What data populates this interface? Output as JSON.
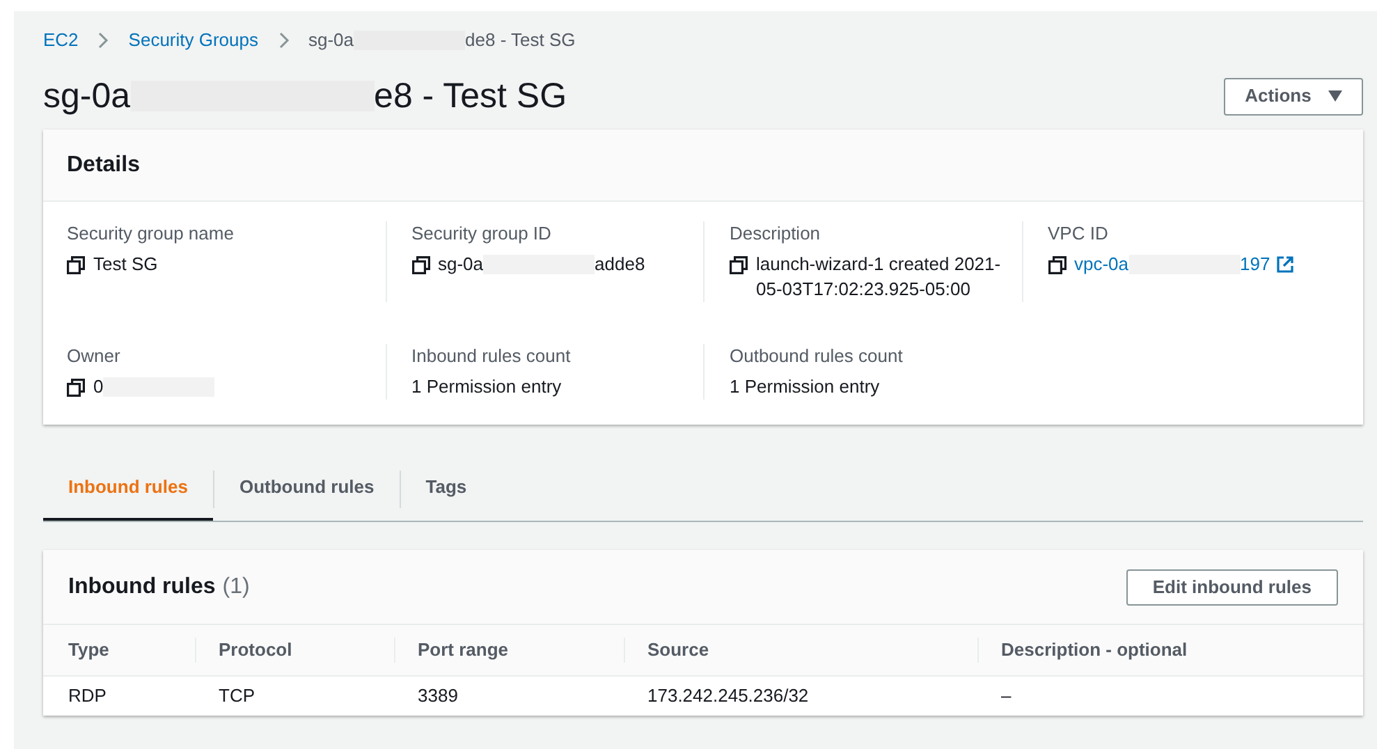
{
  "breadcrumb": [
    {
      "kind": "link",
      "text": "EC2"
    },
    {
      "kind": "link",
      "text": "Security Groups"
    },
    {
      "kind": "redacted",
      "text": "sg-0a",
      "text_end": "de8 - Test SG"
    }
  ],
  "title": {
    "text": "sg-0a",
    "text_end": "e8 - Test SG"
  },
  "actions_button": "Actions",
  "details": {
    "heading": "Details",
    "fields": [
      {
        "label": "Security group name",
        "value": "Test SG",
        "copy": true,
        "kind": "text"
      },
      {
        "label": "Security group ID",
        "value": "sg-0a",
        "value_end": "adde8",
        "copy": true,
        "kind": "redacted"
      },
      {
        "label": "Description",
        "value": "launch-wizard-1 created 2021-05-03T17:02:23.925-05:00",
        "copy": true,
        "kind": "text"
      },
      {
        "label": "VPC ID",
        "value": "vpc-0a",
        "value_end": "197",
        "copy": true,
        "kind": "link"
      },
      {
        "label": "Owner",
        "value": "0",
        "copy": true,
        "kind": "redacted"
      },
      {
        "label": "Inbound rules count",
        "value": "1 Permission entry",
        "copy": false,
        "kind": "text"
      },
      {
        "label": "Outbound rules count",
        "value": "1 Permission entry",
        "copy": false,
        "kind": "text"
      }
    ]
  },
  "tabs": [
    {
      "label": "Inbound rules",
      "selected": true
    },
    {
      "label": "Outbound rules",
      "selected": false
    },
    {
      "label": "Tags",
      "selected": false
    }
  ],
  "rules": {
    "heading": "Inbound rules",
    "count": "(1)",
    "edit_button": "Edit inbound rules",
    "columns": [
      "Type",
      "Protocol",
      "Port range",
      "Source",
      "Description - optional"
    ],
    "rows": [
      [
        "RDP",
        "TCP",
        "3389",
        "173.242.245.236/32",
        "–"
      ]
    ]
  }
}
